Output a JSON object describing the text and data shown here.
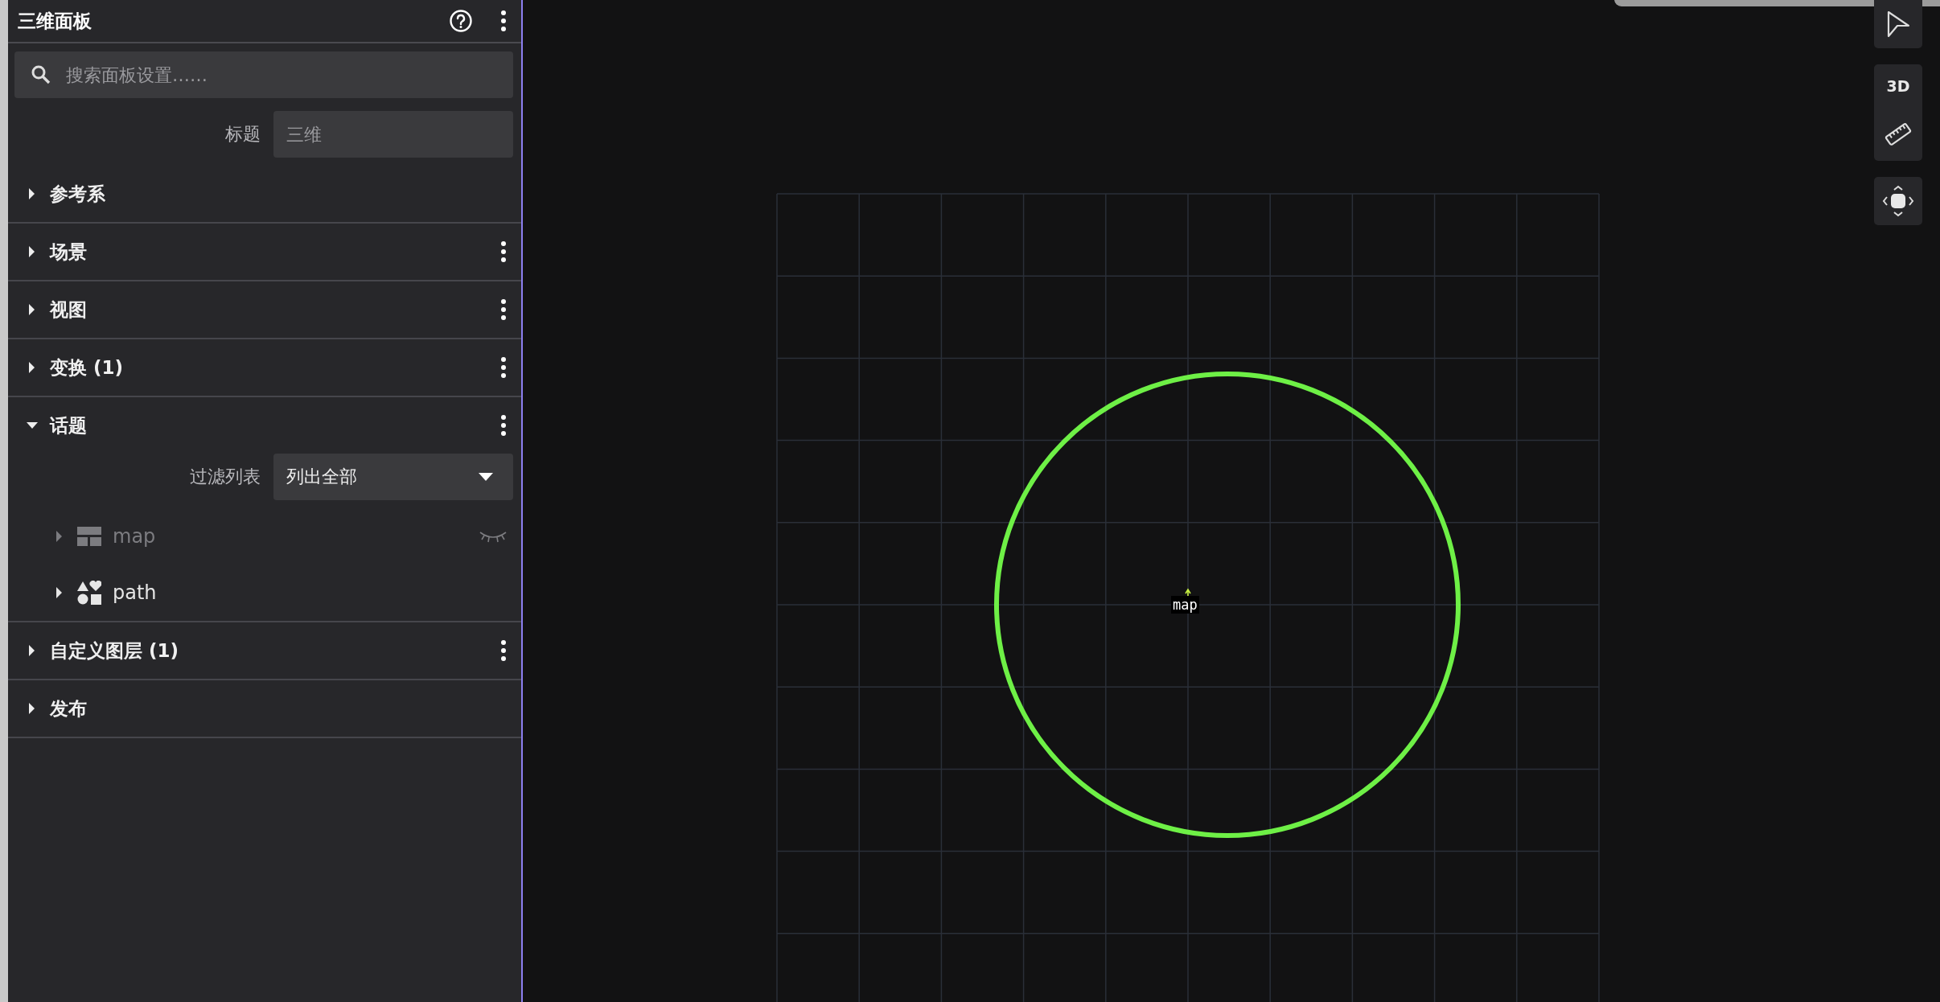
{
  "panel": {
    "title": "三维面板",
    "search": {
      "placeholder": "搜索面板设置……"
    },
    "title_field": {
      "label": "标题",
      "placeholder": "三维"
    },
    "sections": [
      {
        "label": "参考系",
        "expanded": false,
        "menu": false
      },
      {
        "label": "场景",
        "expanded": false,
        "menu": true
      },
      {
        "label": "视图",
        "expanded": false,
        "menu": true
      },
      {
        "label": "变换 (1)",
        "expanded": false,
        "menu": true
      },
      {
        "label": "话题",
        "expanded": true,
        "menu": true,
        "filter": {
          "label": "过滤列表",
          "value": "列出全部"
        },
        "topics": [
          {
            "name": "map",
            "kind": "layout",
            "visible": false,
            "expanded": false
          },
          {
            "name": "path",
            "kind": "shapes",
            "visible": true,
            "expanded": false
          }
        ]
      },
      {
        "label": "自定义图层 (1)",
        "expanded": false,
        "menu": true
      },
      {
        "label": "发布",
        "expanded": false,
        "menu": false
      }
    ]
  },
  "viewport": {
    "label": "map"
  },
  "toolbar": {
    "mode_label": "3D"
  }
}
